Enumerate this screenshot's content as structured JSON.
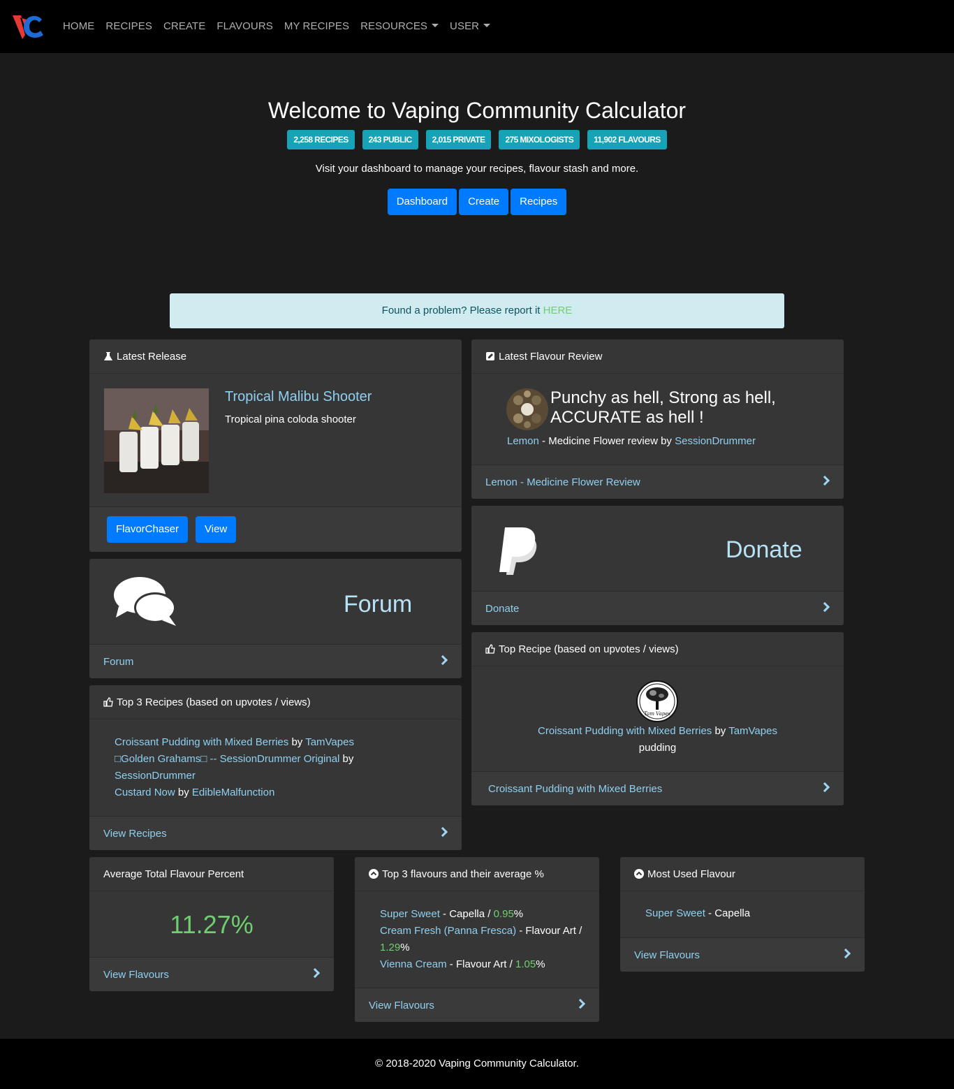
{
  "nav": {
    "items": [
      {
        "label": "HOME"
      },
      {
        "label": "RECIPES"
      },
      {
        "label": "CREATE"
      },
      {
        "label": "FLAVOURS"
      },
      {
        "label": "MY RECIPES"
      },
      {
        "label": "RESOURCES",
        "dropdown": true
      },
      {
        "label": "USER",
        "dropdown": true
      }
    ]
  },
  "hero": {
    "title": "Welcome to Vaping Community Calculator",
    "badges": [
      "2,258 RECIPES",
      "243 PUBLIC",
      "2,015 PRIVATE",
      "275 MIXOLOGISTS",
      "11,902 FLAVOURS"
    ],
    "subtitle": "Visit your dashboard to manage your recipes, flavour stash and more.",
    "buttons": [
      "Dashboard",
      "Create",
      "Recipes"
    ]
  },
  "alert": {
    "text": "Found a problem? Please report it ",
    "link": "HERE"
  },
  "latest_release": {
    "header": "Latest Release",
    "recipe_title": "Tropical Malibu Shooter",
    "recipe_desc": "Tropical pina coloda shooter",
    "author_button": "FlavorChaser",
    "view_button": "View"
  },
  "latest_review": {
    "header": "Latest Flavour Review",
    "quote": "Punchy as hell, Strong as hell, ACCURATE as hell !",
    "flavour_link": "Lemon",
    "middle_text": " - Medicine Flower review by ",
    "reviewer": "SessionDrummer",
    "footer": "Lemon - Medicine Flower Review"
  },
  "forum": {
    "title": "Forum",
    "footer": "Forum"
  },
  "donate": {
    "title": "Donate",
    "footer": "Donate"
  },
  "top3": {
    "header": "Top 3 Recipes (based on upvotes / views)",
    "recipes": [
      {
        "name": "Croissant Pudding with Mixed Berries",
        "by": " by ",
        "author": "TamVapes"
      },
      {
        "name": "□Golden Grahams□ -- SessionDrummer Original",
        "by": " by ",
        "author": "SessionDrummer"
      },
      {
        "name": "Custard Now",
        "by": " by ",
        "author": "EdibleMalfunction"
      }
    ],
    "footer": "View Recipes"
  },
  "top_recipe": {
    "header": "Top Recipe (based on upvotes / views)",
    "name": "Croissant Pudding with Mixed Berries",
    "by": " by ",
    "author": "TamVapes",
    "tag": "pudding",
    "avatar_text": "Tam Vapes",
    "footer": "Croissant Pudding with Mixed Berries"
  },
  "avg_flavour": {
    "header": "Average Total Flavour Percent",
    "value": "11.27%",
    "footer": "View Flavours"
  },
  "top3_flavours": {
    "header": "Top 3 flavours and their average %",
    "items": [
      {
        "name": "Super Sweet",
        "maker": " - Capella / ",
        "pct": "0.95",
        "suffix": "%"
      },
      {
        "name": "Cream Fresh (Panna Fresca)",
        "maker": " - Flavour Art / ",
        "pct": "1.29",
        "suffix": "%"
      },
      {
        "name": "Vienna Cream",
        "maker": " - Flavour Art / ",
        "pct": "1.05",
        "suffix": "%"
      }
    ],
    "footer": "View Flavours"
  },
  "most_used": {
    "header": "Most Used Flavour",
    "name": "Super Sweet",
    "maker": " - Capella",
    "footer": "View Flavours"
  },
  "footer": {
    "copyright": "© 2018-2020 Vaping Community Calculator."
  },
  "colors": {
    "primary": "#007bff",
    "info": "#17a2b8",
    "link": "#8fd0f0",
    "success": "#6fcf6f",
    "card": "#363636",
    "nav": "#000000"
  }
}
